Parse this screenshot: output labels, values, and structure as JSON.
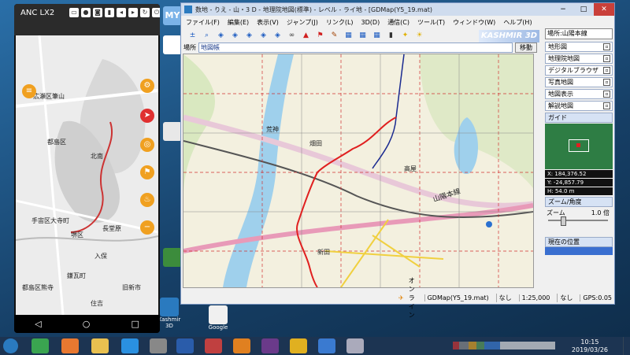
{
  "desktop": {
    "icons": [
      {
        "label": "MY",
        "color": "#7bb3e8"
      },
      {
        "label": "",
        "color": "#ffffff"
      },
      {
        "label": "",
        "color": "#e8e8e8"
      },
      {
        "label": "",
        "color": "#3c8c3c"
      },
      {
        "label": "Kashmir 3D",
        "color": "#2a7abf"
      },
      {
        "label": "Google",
        "color": "#f0f0f0"
      }
    ]
  },
  "phone": {
    "title": "ANC LX2",
    "labels": [
      "広瀬区筆山",
      "都島区",
      "北南",
      "手宙区大寺町",
      "堺区",
      "長堂原",
      "鎌瓦町",
      "都島区熊寺",
      "住吉",
      "旧新市",
      "入保"
    ],
    "nav": {
      "back": "◁",
      "home": "○",
      "recent": "□"
    }
  },
  "window": {
    "title": "数地 - りえ - 山・3 D - 地理院地図(標準) - レベル - ライ地 - [GDMap(Y5_19.mat)",
    "menus": [
      "ファイル(F)",
      "編集(E)",
      "表示(V)",
      "ジャンプ(J)",
      "リンク(L)",
      "3D(D)",
      "通信(C)",
      "ツール(T)",
      "ウィンドウ(W)",
      "ヘルプ(H)"
    ],
    "logo": "KASHMIR 3D",
    "address_label": "場所",
    "address_value": "地図帳",
    "go_button": "移動",
    "status": {
      "online": "オンライン",
      "file": "GDMap(Y5_19.mat)",
      "none": "なし",
      "scale": "1:25,000",
      "zone": "なし",
      "gps": "GPS:0.05"
    },
    "map_labels": [
      "山陽本線",
      "荒神",
      "畑田",
      "高屋",
      "新田"
    ],
    "right_panel": {
      "select": "場所:山陽本線",
      "items": [
        "地形図",
        "地理院地図",
        "デジタルブラウザ",
        "写真地図",
        "地図表示",
        "解説地図"
      ],
      "guide": "ガイド",
      "readouts": [
        "X: 184,376.52",
        "Y: -24,857.79",
        "H: 54.0 m"
      ],
      "zoom_title": "ズーム/角度",
      "zoom_label": "ズーム",
      "zoom_value": "1.0 倍",
      "bottom_title": "現在の位置"
    }
  },
  "taskbar": {
    "time": "10:15",
    "date": "2019/03/26"
  }
}
